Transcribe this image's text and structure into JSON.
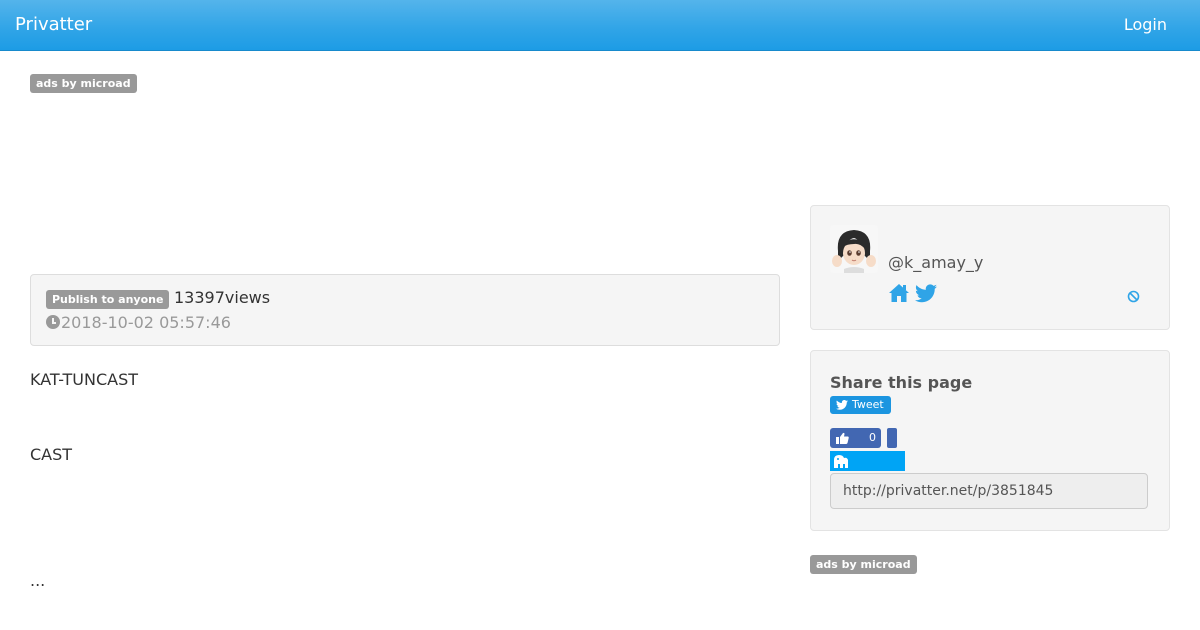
{
  "colors": {
    "navbar": "#2fa4e7",
    "link": "#2fa4e7",
    "label_gray": "#999999",
    "well_bg": "#f5f5f5",
    "tweet_blue": "#1b95e0",
    "facebook_blue": "#4267b2",
    "hatena_blue": "#00a4f5"
  },
  "navbar": {
    "brand": "Privatter",
    "login_label": "Login"
  },
  "ads": {
    "top_label": "ads by microad",
    "bottom_label": "ads by microad"
  },
  "post": {
    "visibility_badge": "Publish to anyone",
    "views_count": "13397",
    "views_suffix": "views",
    "date": "2018-10-02 05:57:46",
    "date_icon": "clock-icon",
    "lines": [
      "KAT-TUNCAST",
      "CAST",
      "..."
    ]
  },
  "user": {
    "username": "@k_amay_y",
    "avatar": "anime-character-avatar",
    "icons": [
      "home-icon",
      "twitter-icon",
      "block-icon"
    ]
  },
  "share": {
    "title": "Share this page",
    "tweet_label": "Tweet",
    "like_count": "0",
    "icons": [
      "twitter-bird-icon",
      "thumbs-up-icon",
      "hatena-bookmark-icon"
    ],
    "url": "http://privatter.net/p/3851845"
  }
}
